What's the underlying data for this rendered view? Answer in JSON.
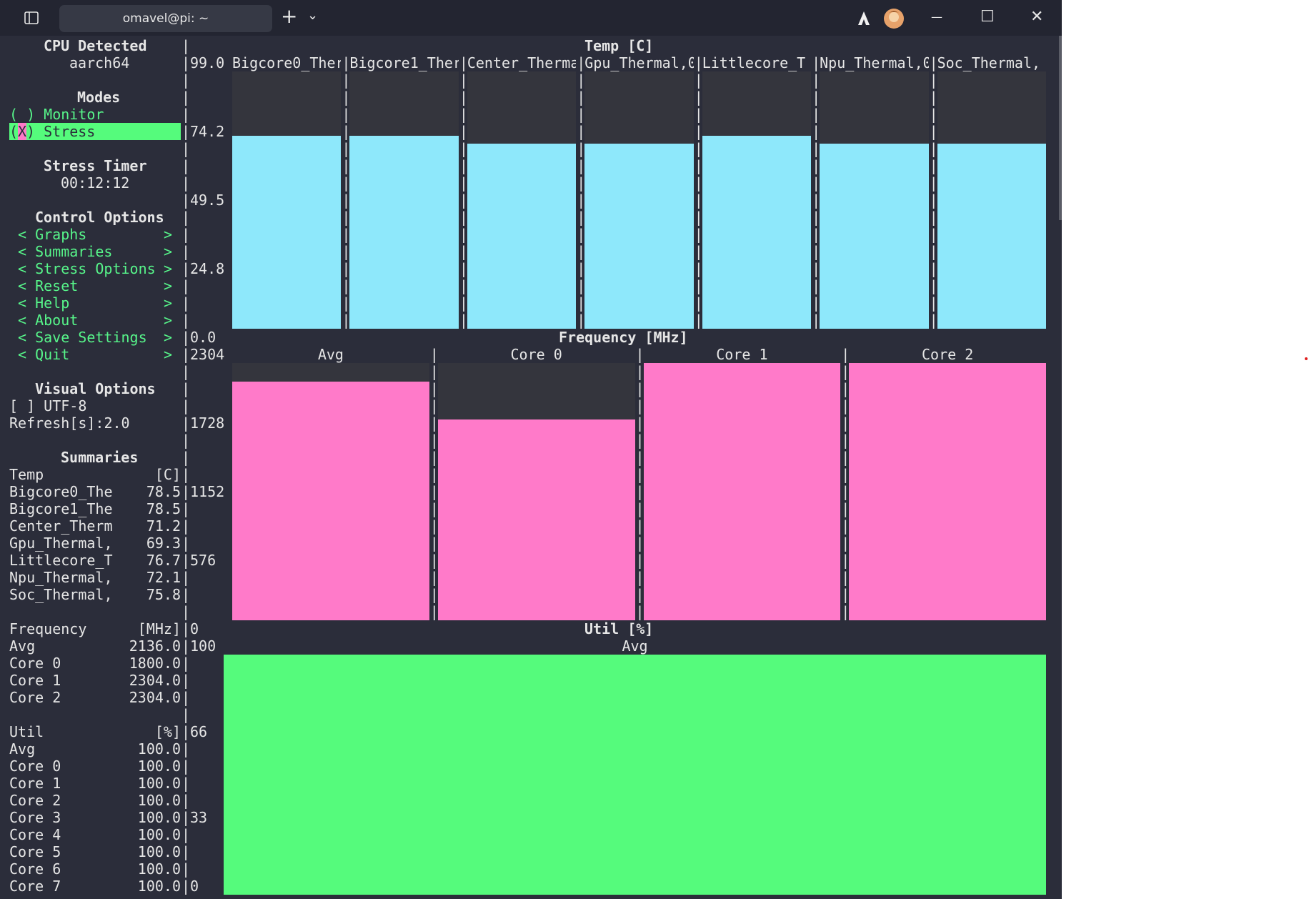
{
  "window": {
    "tab_title": "omavel@pi: ~",
    "new_tab": "+",
    "dropdown": "⌄",
    "minimize": "—",
    "maximize": "☐",
    "close": "✕"
  },
  "sidebar": {
    "cpu_title": "CPU Detected",
    "cpu_value": "aarch64",
    "modes_title": "Modes",
    "mode_monitor": "( ) Monitor",
    "mode_stress_open": "(",
    "mode_stress_x": "X",
    "mode_stress_rest": ") Stress",
    "timer_title": "Stress Timer",
    "timer_value": "00:12:12",
    "control_title": "Control Options",
    "controls": [
      {
        "left": "< Graphs",
        "right": ">"
      },
      {
        "left": "< Summaries",
        "right": ">"
      },
      {
        "left": "< Stress Options",
        "right": ">"
      },
      {
        "left": "< Reset",
        "right": ">"
      },
      {
        "left": "< Help",
        "right": ">"
      },
      {
        "left": "< About",
        "right": ">"
      },
      {
        "left": "< Save Settings",
        "right": ">"
      },
      {
        "left": "< Quit",
        "right": ">"
      }
    ],
    "visual_title": "Visual Options",
    "utf8": "[ ] UTF-8",
    "refresh": "Refresh[s]:2.0",
    "summaries_title": "Summaries",
    "temp_header": [
      "Temp",
      "[C]"
    ],
    "temp_rows": [
      [
        "Bigcore0_The",
        "78.5"
      ],
      [
        "Bigcore1_The",
        "78.5"
      ],
      [
        "Center_Therm",
        "71.2"
      ],
      [
        "Gpu_Thermal,",
        "69.3"
      ],
      [
        "Littlecore_T",
        "76.7"
      ],
      [
        "Npu_Thermal,",
        "72.1"
      ],
      [
        "Soc_Thermal,",
        "75.8"
      ]
    ],
    "freq_header": [
      "Frequency",
      "[MHz]"
    ],
    "freq_rows": [
      [
        "Avg",
        "2136.0"
      ],
      [
        "Core 0",
        "1800.0"
      ],
      [
        "Core 1",
        "2304.0"
      ],
      [
        "Core 2",
        "2304.0"
      ]
    ],
    "util_header": [
      "Util",
      "[%]"
    ],
    "util_rows": [
      [
        "Avg",
        "100.0"
      ],
      [
        "Core 0",
        "100.0"
      ],
      [
        "Core 1",
        "100.0"
      ],
      [
        "Core 2",
        "100.0"
      ],
      [
        "Core 3",
        "100.0"
      ],
      [
        "Core 4",
        "100.0"
      ],
      [
        "Core 5",
        "100.0"
      ],
      [
        "Core 6",
        "100.0"
      ],
      [
        "Core 7",
        "100.0"
      ]
    ]
  },
  "graphs": {
    "temp": {
      "title": "Temp [C]",
      "ticks": [
        "99.0",
        "74.2",
        "49.5",
        "24.8",
        "0.0"
      ],
      "ymax": 99.0,
      "labels": [
        "Bigcore0_Ther",
        "Bigcore1_Ther",
        "Center_Therma",
        "Gpu_Thermal,0",
        "Littlecore_T",
        "Npu_Thermal,0",
        "Soc_Thermal,"
      ],
      "values": [
        74.2,
        74.2,
        71.2,
        71.2,
        74.2,
        71.2,
        71.2
      ]
    },
    "freq": {
      "title": "Frequency [MHz]",
      "ticks": [
        "2304",
        "1728",
        "1152",
        "576",
        "0"
      ],
      "ymax": 2304,
      "labels": [
        "Avg",
        "Core 0",
        "Core 1",
        "Core 2"
      ],
      "values": [
        2136,
        1800,
        2304,
        2304
      ]
    },
    "util": {
      "title": "Util [%]",
      "ticks": [
        "100",
        "66",
        "33",
        "0"
      ],
      "ymax": 100,
      "labels": [
        "Avg"
      ],
      "values": [
        100
      ]
    }
  },
  "colors": {
    "temp_bar": "#8ee8fb",
    "freq_bar": "#ff7ac9",
    "util_bar": "#55fb7c",
    "menu_green": "#57f58a",
    "background": "#2b2d3a"
  }
}
